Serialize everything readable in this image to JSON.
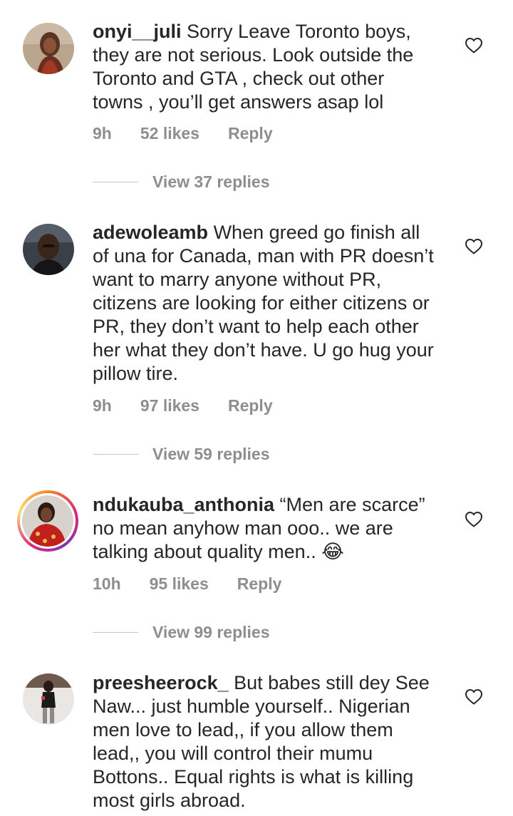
{
  "comments": [
    {
      "username": "onyi__juli",
      "text": " Sorry Leave Toronto boys,\nthey are not serious. Look outside the\nToronto and GTA , check out other\ntowns , you’ll get answers asap lol",
      "time": "9h",
      "likes": "52 likes",
      "reply_label": "Reply",
      "view_replies": "View 37 replies"
    },
    {
      "username": "adewoleamb",
      "text": " When greed go finish all\nof una for Canada, man with PR doesn’t\nwant to marry anyone without PR,\ncitizens are looking for either citizens or\nPR, they don’t want to help each other\nher what they don’t have. U go hug your\npillow tire.",
      "time": "9h",
      "likes": "97 likes",
      "reply_label": "Reply",
      "view_replies": "View 59 replies"
    },
    {
      "username": "ndukauba_anthonia",
      "text": " “Men are scarce”\nno mean anyhow man ooo.. we are\ntalking about quality men.. 😂",
      "time": "10h",
      "likes": "95 likes",
      "reply_label": "Reply",
      "view_replies": "View 99 replies"
    },
    {
      "username": "preesheerock_",
      "text": " But babes still dey See\nNaw... just humble yourself.. Nigerian\nmen love to lead,, if you allow them\nlead,, you will control their mumu\nBottons.. Equal rights is what is killing\nmost girls abroad.",
      "time": "",
      "likes": "",
      "reply_label": "",
      "view_replies": ""
    }
  ],
  "icons": {
    "like": "heart-outline-icon"
  },
  "colors": {
    "text": "#262626",
    "muted": "#8e8e8e",
    "story_ring": "#dd2a7b"
  }
}
